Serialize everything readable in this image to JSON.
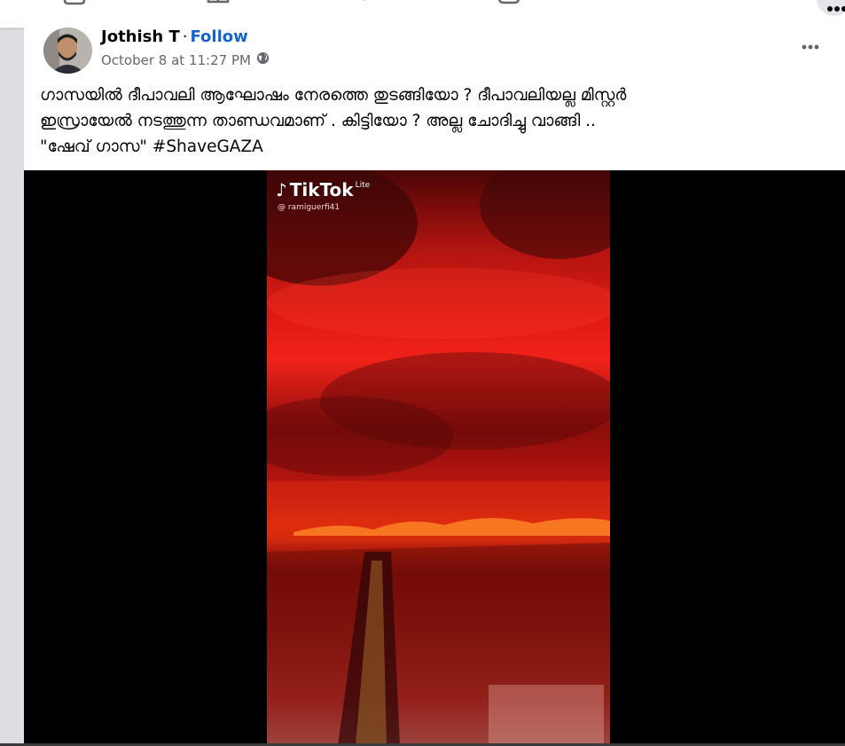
{
  "nav": {
    "icons": [
      "home-icon",
      "marketplace-icon",
      "groups-icon",
      "gaming-icon",
      "menu-icon"
    ]
  },
  "post": {
    "author": "Jothish T",
    "separator": "·",
    "follow_label": "Follow",
    "timestamp": "October 8 at 11:27 PM",
    "audience_icon": "globe-icon",
    "more_icon": "more-options-icon",
    "text": "ഗാസയിൽ ദീപാവലി ആഘോഷം നേരത്തെ തുടങ്ങിയോ ? ദീപാവലിയല്ല മിസ്റ്റർ\nഇസ്രായേൽ നടത്തുന്ന താണ്ഡവമാണ് . കിട്ടിയോ ? അല്ല ചോദിച്ചു വാങ്ങി ..\n\"ഷേവ് ഗാസ\" #ShaveGAZA"
  },
  "video": {
    "watermark": "TikTok",
    "watermark_suffix": "Lite",
    "username": "@ ramiguerfi41"
  },
  "colors": {
    "accent": "#1764c9",
    "secondary_text": "#65676b",
    "video_background": "#000000"
  }
}
